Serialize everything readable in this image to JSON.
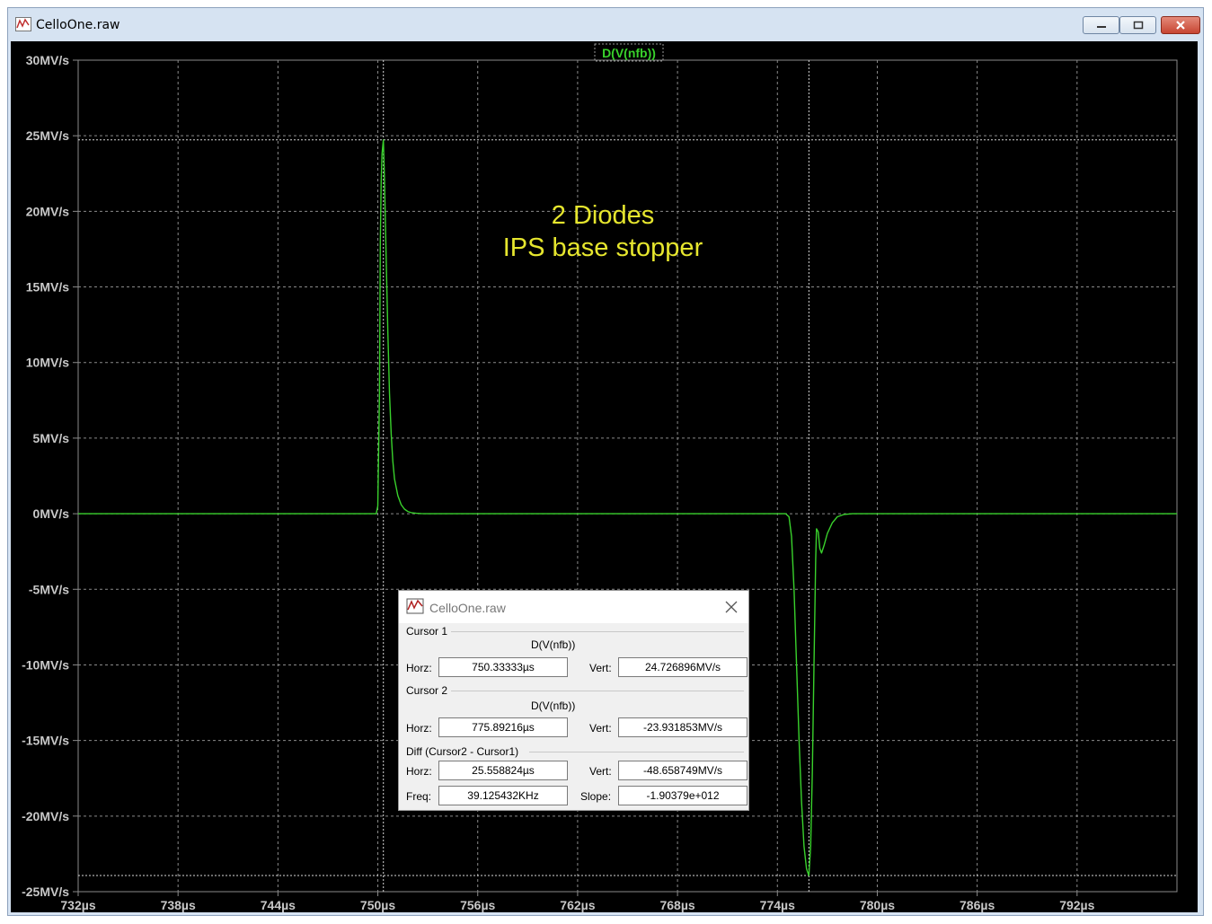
{
  "window": {
    "title": "CelloOne.raw",
    "buttons": {
      "minimize": "minimize",
      "maximize": "maximize",
      "close": "close"
    }
  },
  "chart_data": {
    "type": "line",
    "title": "D(V(nfb))",
    "xlabel": "",
    "ylabel": "",
    "xlim": [
      732,
      798
    ],
    "ylim": [
      -25,
      30
    ],
    "x_ticks": [
      "732µs",
      "738µs",
      "744µs",
      "750µs",
      "756µs",
      "762µs",
      "768µs",
      "774µs",
      "780µs",
      "786µs",
      "792µs"
    ],
    "x_tick_values": [
      732,
      738,
      744,
      750,
      756,
      762,
      768,
      774,
      780,
      786,
      792
    ],
    "y_ticks": [
      "30MV/s",
      "25MV/s",
      "20MV/s",
      "15MV/s",
      "10MV/s",
      "5MV/s",
      "0MV/s",
      "-5MV/s",
      "-10MV/s",
      "-15MV/s",
      "-20MV/s",
      "-25MV/s"
    ],
    "y_tick_values": [
      30,
      25,
      20,
      15,
      10,
      5,
      0,
      -5,
      -10,
      -15,
      -20,
      -25
    ],
    "grid": true,
    "colors": {
      "background": "#000000",
      "trace": "#39d12c",
      "grid": "#8a8a8a",
      "text": "#c8c8c8",
      "annotation": "#e6e62e",
      "cursor": "#d8d8d8"
    },
    "series": [
      {
        "name": "D(V(nfb))",
        "x": [
          732.0,
          749.9,
          750.0,
          750.1,
          750.15,
          750.2,
          750.25,
          750.33,
          750.4,
          750.5,
          750.6,
          750.7,
          750.8,
          750.9,
          751.0,
          751.2,
          751.4,
          751.6,
          751.8,
          752.0,
          752.3,
          752.6,
          753.0,
          753.5,
          754.0,
          755.0,
          756.0,
          774.5,
          774.7,
          774.85,
          775.0,
          775.15,
          775.3,
          775.45,
          775.6,
          775.75,
          775.89,
          776.0,
          776.1,
          776.2,
          776.3,
          776.35,
          776.45,
          776.55,
          776.65,
          776.8,
          777.0,
          777.3,
          777.6,
          778.0,
          778.5,
          779.0,
          780.0,
          798.0
        ],
        "y": [
          0,
          0,
          0.5,
          8,
          18,
          22,
          23.8,
          24.73,
          22,
          17,
          12,
          8,
          5.3,
          3.5,
          2.3,
          1.2,
          0.6,
          0.3,
          0.15,
          0.07,
          0.03,
          0.01,
          0,
          0,
          0,
          0,
          0,
          0,
          -0.2,
          -1.5,
          -5,
          -10,
          -15,
          -19,
          -22,
          -23.5,
          -23.93,
          -22,
          -17,
          -10,
          -3,
          -1,
          -1.2,
          -2.3,
          -2.6,
          -2.1,
          -1.3,
          -0.6,
          -0.2,
          -0.05,
          0,
          0,
          0,
          0
        ]
      }
    ],
    "annotation": {
      "lines": [
        "2 Diodes",
        "IPS base stopper"
      ]
    },
    "cursors": [
      {
        "label": "Cursor 1",
        "x": 750.33333,
        "y": 24.726896
      },
      {
        "label": "Cursor 2",
        "x": 775.89216,
        "y": -23.931853
      }
    ]
  },
  "cursor_dialog": {
    "title": "CelloOne.raw",
    "cursor1": {
      "section": "Cursor 1",
      "trace": "D(V(nfb))",
      "horz_label": "Horz:",
      "horz": "750.33333µs",
      "vert_label": "Vert:",
      "vert": "24.726896MV/s"
    },
    "cursor2": {
      "section": "Cursor 2",
      "trace": "D(V(nfb))",
      "horz_label": "Horz:",
      "horz": "775.89216µs",
      "vert_label": "Vert:",
      "vert": "-23.931853MV/s"
    },
    "diff": {
      "section": "Diff (Cursor2 - Cursor1)",
      "horz_label": "Horz:",
      "horz": "25.558824µs",
      "vert_label": "Vert:",
      "vert": "-48.658749MV/s",
      "freq_label": "Freq:",
      "freq": "39.125432KHz",
      "slope_label": "Slope:",
      "slope": "-1.90379e+012"
    }
  }
}
